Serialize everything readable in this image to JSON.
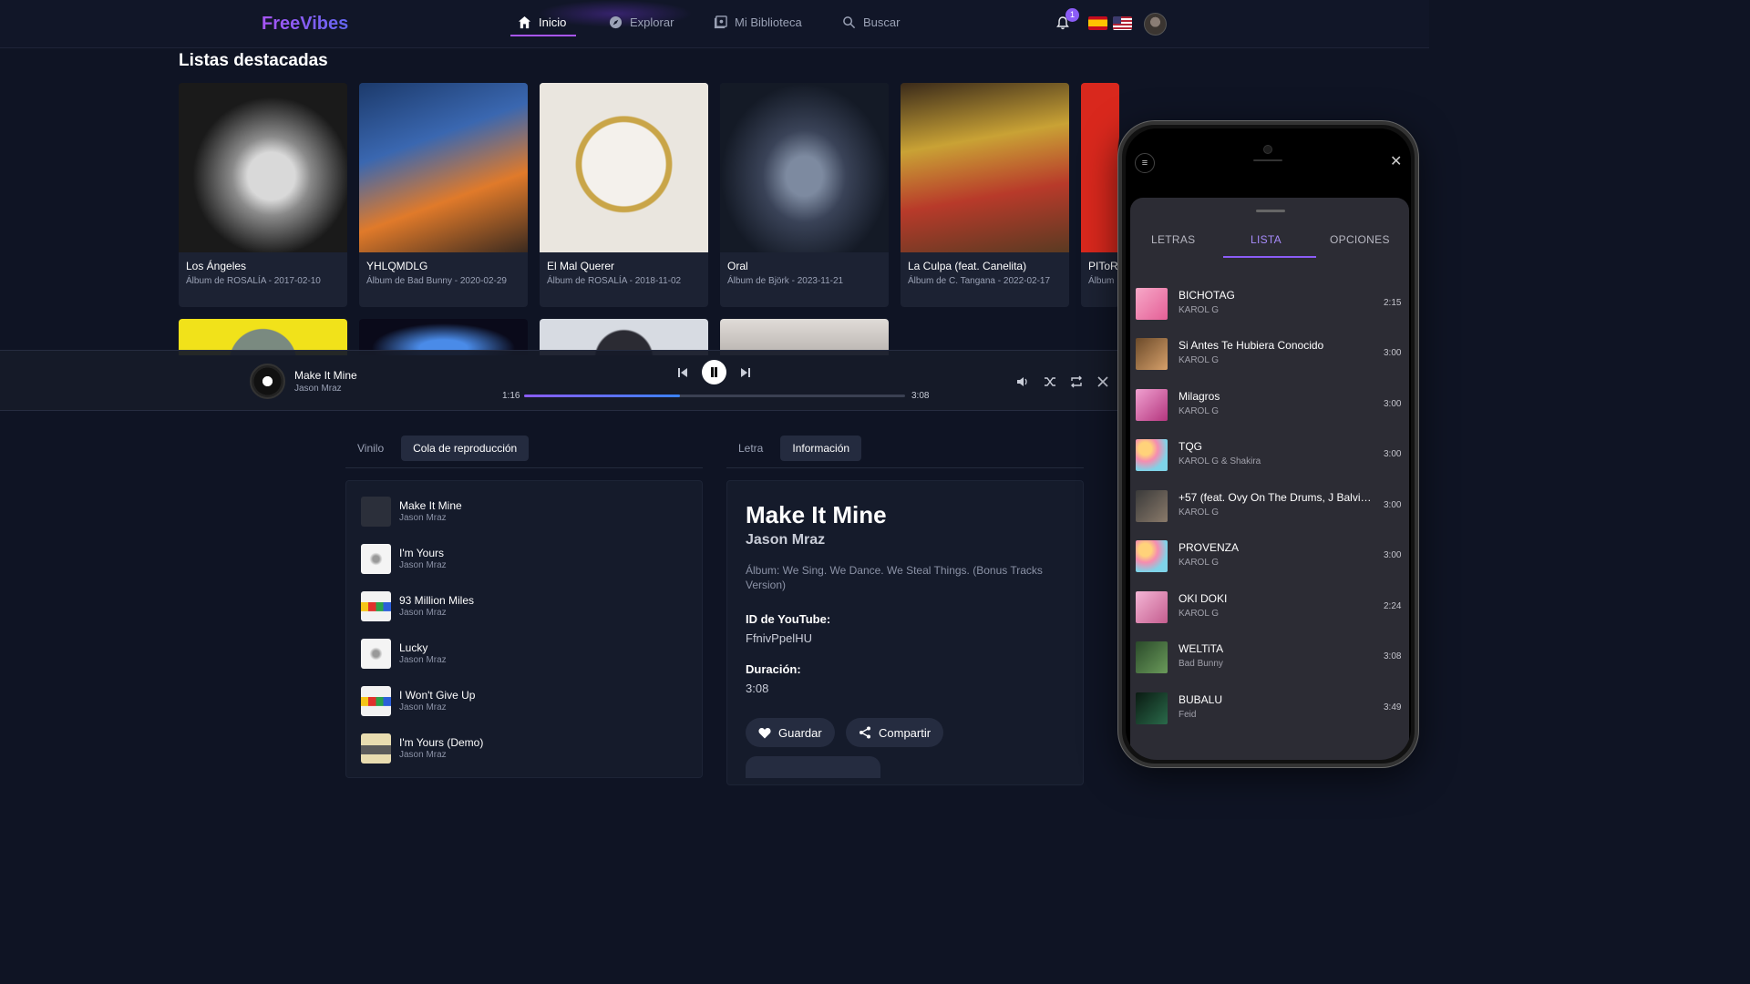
{
  "nav": {
    "brand": "FreeVibes",
    "items": [
      {
        "label": "Inicio"
      },
      {
        "label": "Explorar"
      },
      {
        "label": "Mi Biblioteca"
      },
      {
        "label": "Buscar"
      }
    ],
    "notification_count": "1"
  },
  "featured": {
    "title": "Listas destacadas",
    "cards": [
      {
        "title": "Los Ángeles",
        "subtitle": "Álbum de ROSALÍA - 2017-02-10"
      },
      {
        "title": "YHLQMDLG",
        "subtitle": "Álbum de Bad Bunny - 2020-02-29"
      },
      {
        "title": "El Mal Querer",
        "subtitle": "Álbum de ROSALÍA - 2018-11-02"
      },
      {
        "title": "Oral",
        "subtitle": "Álbum de Björk - 2023-11-21"
      },
      {
        "title": "La Culpa (feat. Canelita)",
        "subtitle": "Álbum de C. Tangana - 2022-02-17"
      },
      {
        "title": "PIToR",
        "subtitle": "Álbum"
      }
    ]
  },
  "player": {
    "title": "Make It Mine",
    "artist": "Jason Mraz",
    "current_time": "1:16",
    "total_time": "3:08",
    "progress": 0.41
  },
  "left_panel": {
    "tabs": [
      {
        "label": "Vinilo"
      },
      {
        "label": "Cola de reproducción"
      }
    ],
    "queue": [
      {
        "title": "Make It Mine",
        "artist": "Jason Mraz"
      },
      {
        "title": "I'm Yours",
        "artist": "Jason Mraz"
      },
      {
        "title": "93 Million Miles",
        "artist": "Jason Mraz"
      },
      {
        "title": "Lucky",
        "artist": "Jason Mraz"
      },
      {
        "title": "I Won't Give Up",
        "artist": "Jason Mraz"
      },
      {
        "title": "I'm Yours (Demo)",
        "artist": "Jason Mraz"
      }
    ]
  },
  "right_panel": {
    "tabs": [
      {
        "label": "Letra"
      },
      {
        "label": "Información"
      }
    ],
    "title": "Make It Mine",
    "artist": "Jason Mraz",
    "album": "Álbum: We Sing. We Dance. We Steal Things. (Bonus Tracks Version)",
    "youtube_label": "ID de YouTube:",
    "youtube_id": "FfnivPpelHU",
    "duration_label": "Duración:",
    "duration": "3:08",
    "save_label": "Guardar",
    "share_label": "Compartir"
  },
  "phone": {
    "tabs": [
      {
        "label": "LETRAS"
      },
      {
        "label": "LISTA"
      },
      {
        "label": "OPCIONES"
      }
    ],
    "songs": [
      {
        "title": "BICHOTAG",
        "artist": "KAROL G",
        "duration": "2:15"
      },
      {
        "title": "Si Antes Te Hubiera Conocido",
        "artist": "KAROL G",
        "duration": "3:00"
      },
      {
        "title": "Milagros",
        "artist": "KAROL G",
        "duration": "3:00"
      },
      {
        "title": "TQG",
        "artist": "KAROL G & Shakira",
        "duration": "3:00"
      },
      {
        "title": "+57 (feat. Ovy On The Drums, J Balvin, ...",
        "artist": "KAROL G",
        "duration": "3:00"
      },
      {
        "title": "PROVENZA",
        "artist": "KAROL G",
        "duration": "3:00"
      },
      {
        "title": "OKI DOKI",
        "artist": "KAROL G",
        "duration": "2:24"
      },
      {
        "title": "WELTiTA",
        "artist": "Bad Bunny",
        "duration": "3:08"
      },
      {
        "title": "BUBALU",
        "artist": "Feid",
        "duration": "3:49"
      }
    ]
  },
  "colors": {
    "accent": "#8b5cf6",
    "background": "#0f1424"
  }
}
